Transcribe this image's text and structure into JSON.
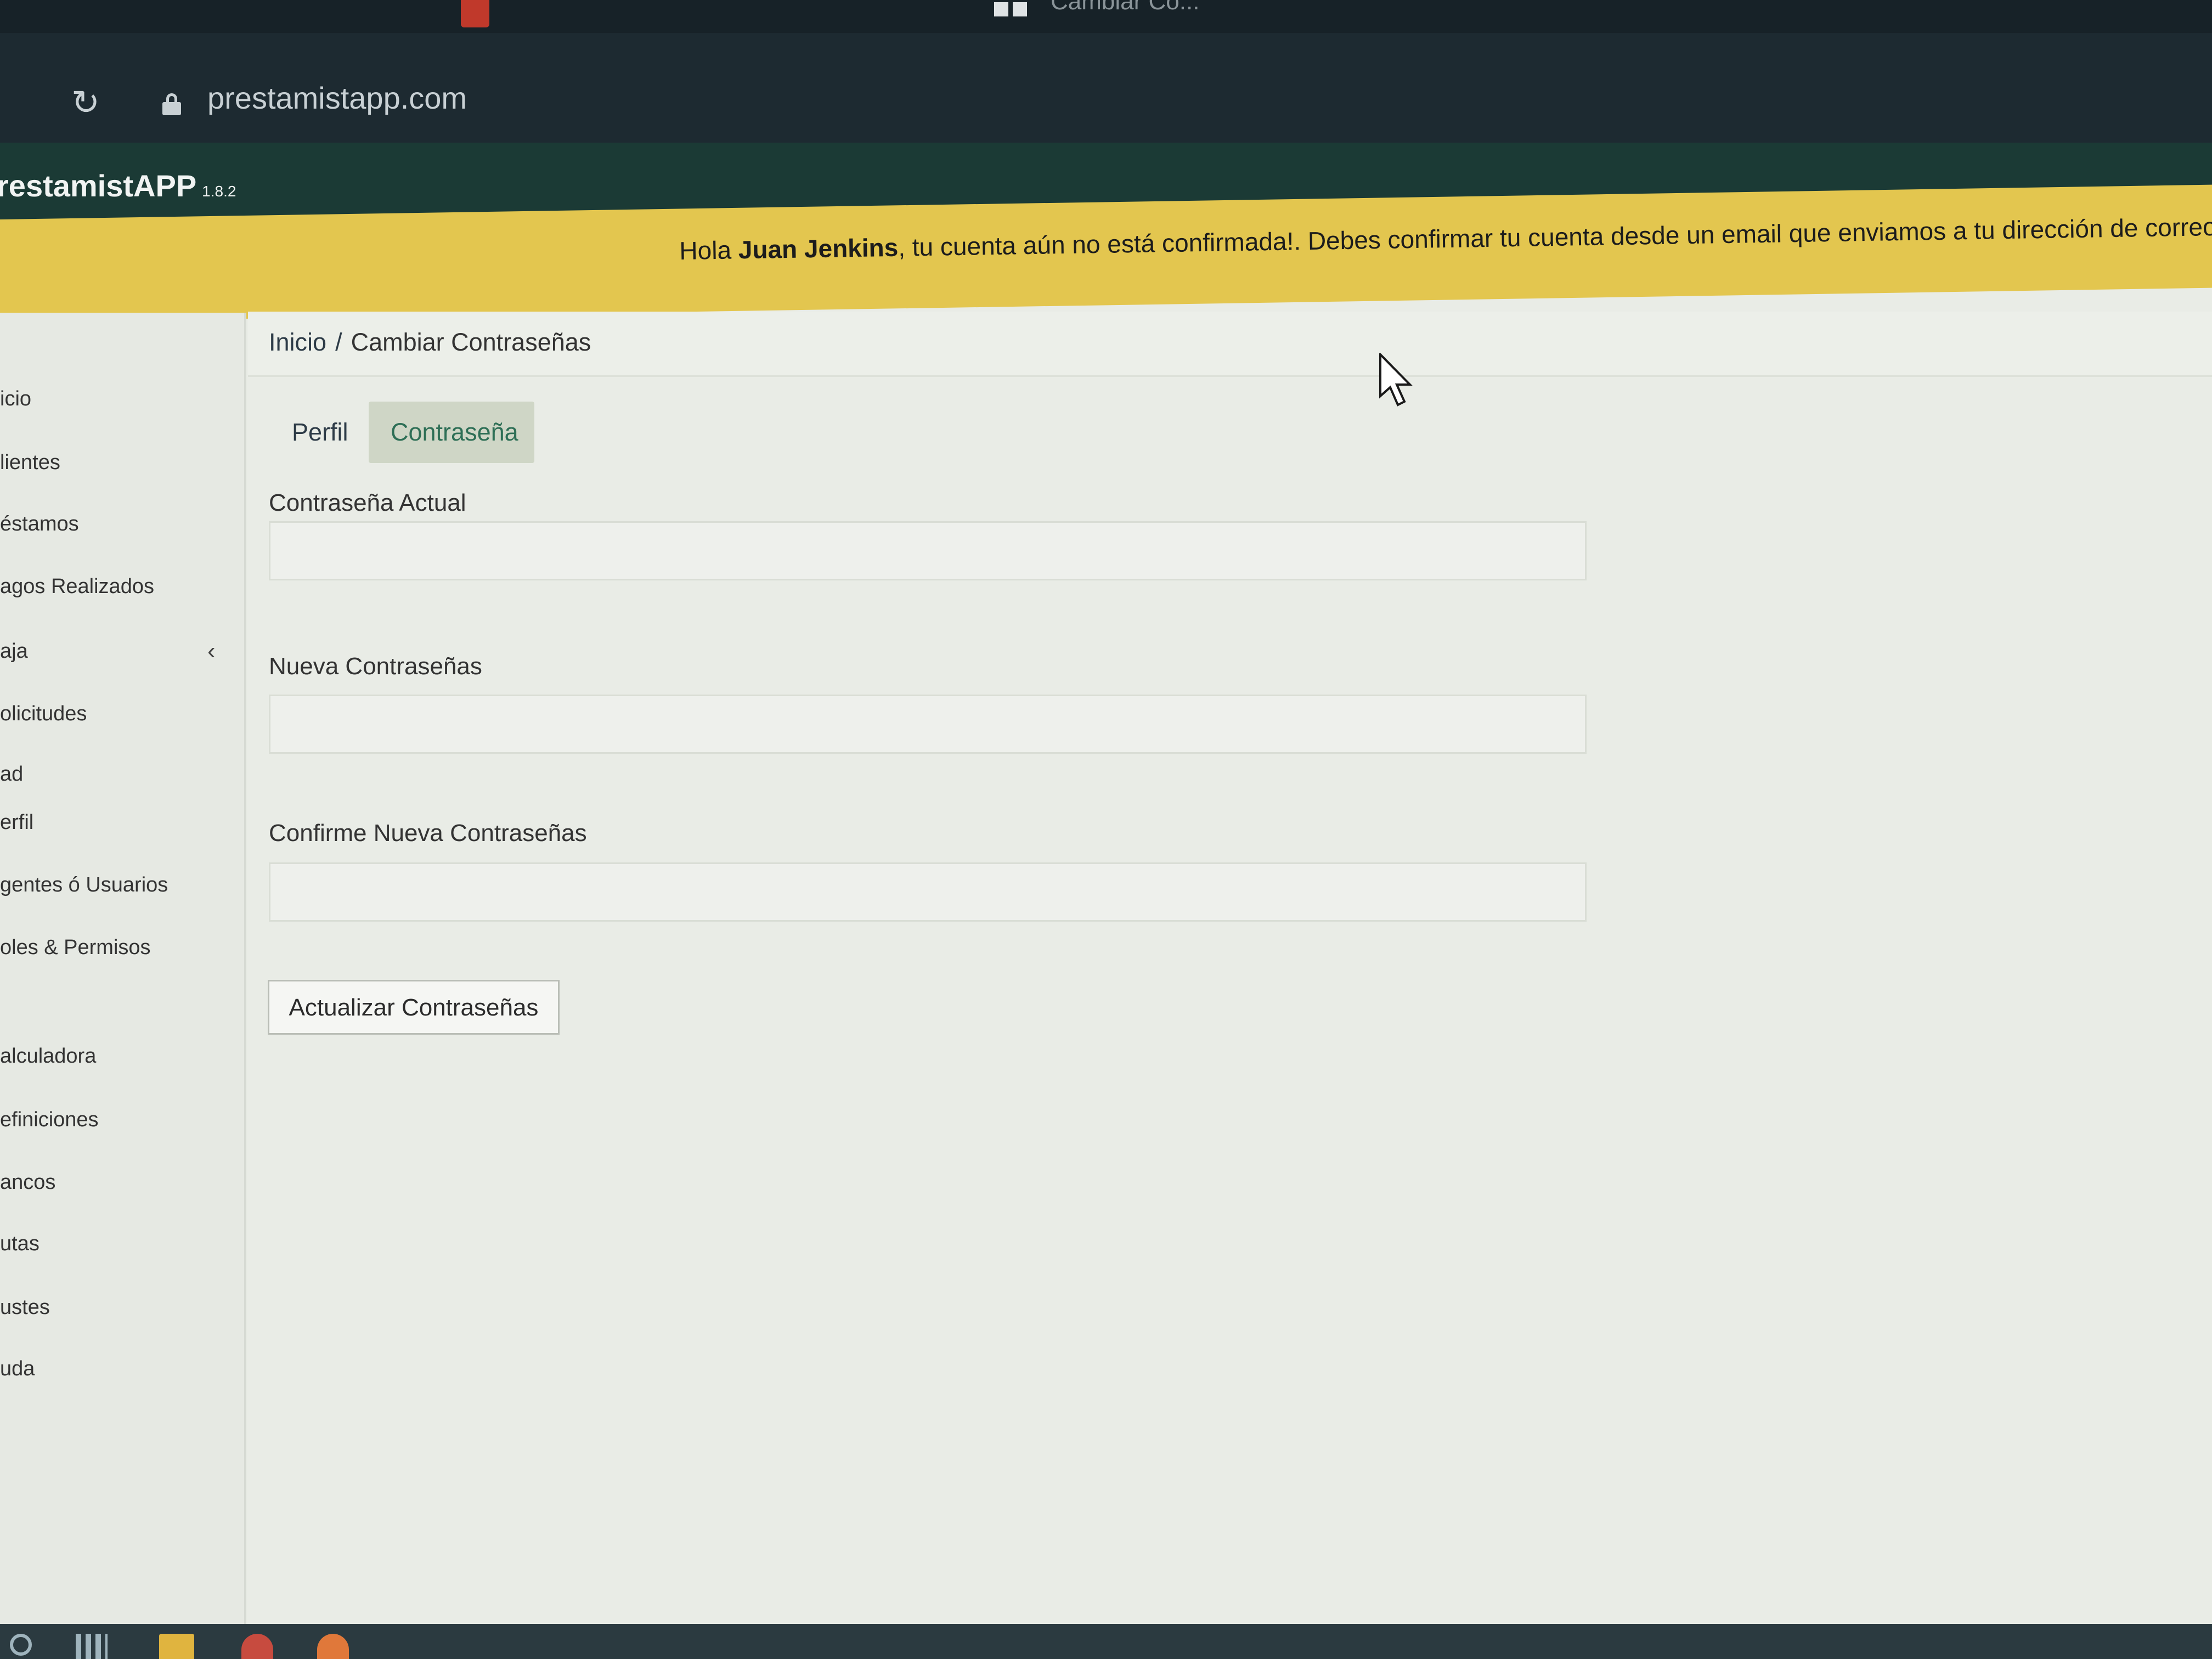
{
  "browser": {
    "url": "prestamistapp.com",
    "tab_title": "Cambiar Co..."
  },
  "app": {
    "name": "restamistAPP",
    "version": "1.8.2"
  },
  "alert": {
    "prefix": "Hola ",
    "user": "Juan Jenkins",
    "message": ", tu cuenta aún no está confirmada!. Debes confirmar tu cuenta desde un email que enviamos a tu dirección de correo"
  },
  "sidebar": {
    "items": [
      {
        "label": "icio"
      },
      {
        "label": "lientes"
      },
      {
        "label": "éstamos"
      },
      {
        "label": "agos Realizados"
      },
      {
        "label": "aja"
      },
      {
        "label": "olicitudes"
      },
      {
        "label": "ad"
      },
      {
        "label": "erfil"
      },
      {
        "label": "gentes ó Usuarios"
      },
      {
        "label": "oles & Permisos"
      },
      {
        "label": "alculadora"
      },
      {
        "label": "efiniciones"
      },
      {
        "label": "ancos"
      },
      {
        "label": "utas"
      },
      {
        "label": "ustes"
      },
      {
        "label": "uda"
      }
    ],
    "chevron": "‹"
  },
  "breadcrumb": {
    "home": "Inicio",
    "separator": "/",
    "current": "Cambiar Contraseñas"
  },
  "tabs": [
    {
      "label": "Perfil"
    },
    {
      "label": "Contraseña",
      "active": true
    }
  ],
  "form": {
    "current_password_label": "Contraseña Actual",
    "new_password_label": "Nueva Contraseñas",
    "confirm_password_label": "Confirme Nueva Contraseñas",
    "submit_label": "Actualizar Contraseñas"
  },
  "icons": {
    "reload": "reload-icon",
    "lock": "lock-icon",
    "cursor": "cursor-icon"
  },
  "colors": {
    "alert_bg": "#e3c64f",
    "header_bg": "#1b3a35",
    "active_tab_text": "#2e6f56"
  }
}
